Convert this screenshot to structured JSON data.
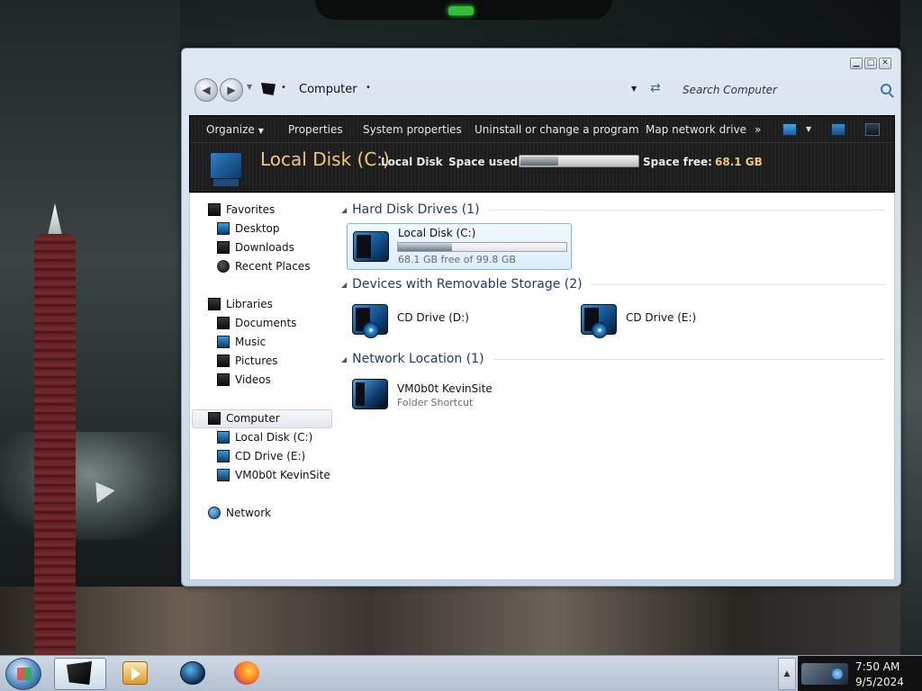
{
  "window": {
    "controls": {
      "minimize": "▁",
      "maximize": "□",
      "close": "✕"
    }
  },
  "navbar": {
    "back_glyph": "◀",
    "forward_glyph": "▶",
    "address_separator": "•",
    "address": "Computer",
    "search_placeholder": "Search Computer"
  },
  "toolbar": {
    "organize": "Organize",
    "properties": "Properties",
    "system_properties": "System properties",
    "uninstall": "Uninstall or change a program",
    "map_network": "Map network drive",
    "more": "»"
  },
  "details_header": {
    "title": "Local Disk (C:)",
    "label": "Local Disk",
    "space_used_label": "Space used:",
    "space_used_fraction": 0.32,
    "space_free_label": "Space free:",
    "space_free_value": "68.1 GB"
  },
  "nav_pane": {
    "favorites": "Favorites",
    "desktop": "Desktop",
    "downloads": "Downloads",
    "recent_places": "Recent Places",
    "libraries": "Libraries",
    "documents": "Documents",
    "music": "Music",
    "pictures": "Pictures",
    "videos": "Videos",
    "computer": "Computer",
    "local_disk": "Local Disk (C:)",
    "cd_drive_e": "CD Drive (E:)",
    "kevinsite": "VM0b0t KevinSite",
    "network": "Network"
  },
  "content": {
    "hard_disk_header": "Hard Disk Drives (1)",
    "local_disk_name": "Local Disk (C:)",
    "local_disk_usage_fraction": 0.32,
    "local_disk_free": "68.1 GB free of 99.8 GB",
    "removable_header": "Devices with Removable Storage (2)",
    "cd_drive_d": "CD Drive (D:)",
    "cd_drive_e": "CD Drive (E:)",
    "network_header": "Network Location (1)",
    "kevinsite_name": "VM0b0t KevinSite",
    "kevinsite_type": "Folder Shortcut"
  },
  "taskbar": {
    "tray_arrow": "▲",
    "time": "7:50 AM",
    "date": "9/5/2024"
  }
}
